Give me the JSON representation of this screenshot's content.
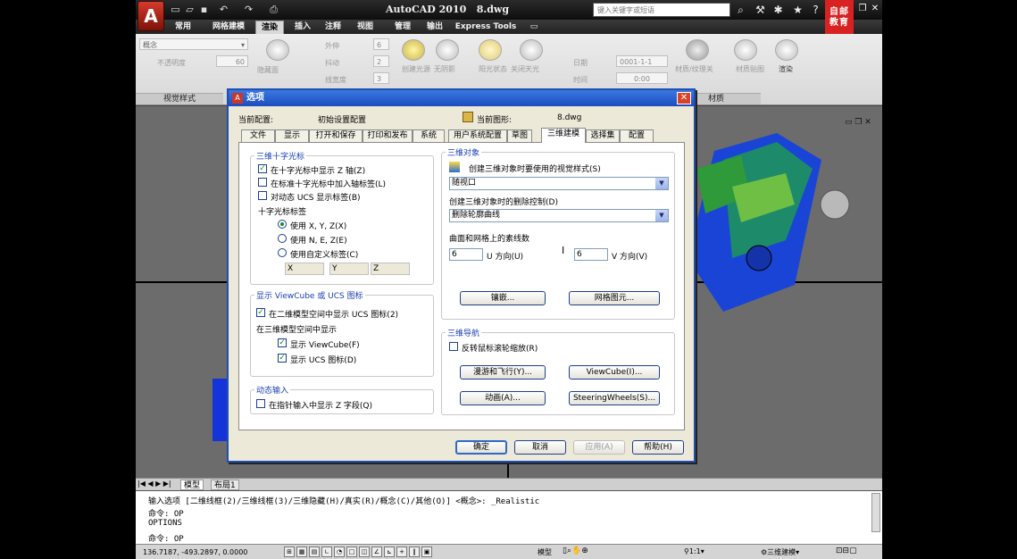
{
  "app": {
    "title": "AutoCAD 2010   8.dwg",
    "search_placeholder": "键入关键字或短语",
    "logo_glyph": "A",
    "brand_line1": "自邮",
    "brand_line2": "教育",
    "colors": {
      "titlebar": "#1a1a1a",
      "dialog_title": "#2a62d6",
      "brand": "#d82222"
    }
  },
  "ribbon_tabs": [
    "常用",
    "网格建模",
    "渲染",
    "插入",
    "注释",
    "视图",
    "管理",
    "输出",
    "Express Tools"
  ],
  "active_ribbon_tab": "渲染",
  "ribbon": {
    "visual_style": "概念",
    "visual_style_label": "视觉样式",
    "items": {
      "lumps": "外伸",
      "lumps_val": "6",
      "color_val": "2",
      "jitter": "抖动",
      "line_width": "线宽度",
      "line_width_val": "3",
      "opacity": "不透明度",
      "opacity_val": "60",
      "xray": "隐藏面",
      "lights": "创建光源",
      "no_shadow": "无阴影",
      "sun": "阳光状态",
      "sun_off": "关闭天光",
      "date_label": "日期",
      "date_val": "0001-1-1",
      "time_label": "时间",
      "time_val": "0:00",
      "materials_browser": "材质/纹理关",
      "material_map": "材质贴图",
      "render": "渲染",
      "materials": "材质"
    }
  },
  "dialog": {
    "title": "选项",
    "current_profile_label": "当前配置:",
    "current_profile_value": "初始设置配置",
    "current_drawing_label": "当前图形:",
    "current_drawing_value": "8.dwg",
    "tabs": [
      "文件",
      "显示",
      "打开和保存",
      "打印和发布",
      "系统",
      "用户系统配置",
      "草图",
      "三维建模",
      "选择集",
      "配置"
    ],
    "active_tab": "三维建模",
    "crosshair": {
      "group_title": "三维十字光标",
      "show_z_axis": "在十字光标中显示 Z 轴(Z)",
      "show_z_axis_checked": true,
      "label_axes": "在标准十字光标中加入轴标签(L)",
      "label_axes_checked": false,
      "dynamic_ucs_labels": "对动态 UCS 显示标签(B)",
      "dynamic_ucs_labels_checked": false,
      "crosshair_labels_title": "十字光标标签",
      "use_xyz": "使用 X, Y, Z(X)",
      "use_nez": "使用 N, E, Z(E)",
      "use_custom": "使用自定义标签(C)",
      "selected": "xyz",
      "custom_x": "X",
      "custom_y": "Y",
      "custom_z": "Z"
    },
    "viewcube": {
      "group_title": "显示 ViewCube 或 UCS 图标",
      "show_ucs_2d": "在二维模型空间中显示 UCS 图标(2)",
      "show_ucs_2d_checked": true,
      "in_3d_title": "在三维模型空间中显示",
      "show_viewcube": "显示 ViewCube(F)",
      "show_viewcube_checked": true,
      "show_ucs_icon": "显示 UCS 图标(D)",
      "show_ucs_icon_checked": true
    },
    "dynamic_input": {
      "group_title": "动态输入",
      "show_z_field": "在指针输入中显示 Z 字段(Q)",
      "show_z_field_checked": false
    },
    "objects_3d": {
      "group_title": "三维对象",
      "visual_style_label": "创建三维对象时要使用的视觉样式(S)",
      "visual_style_value": "随视口",
      "deletion_label": "创建三维对象时的删除控制(D)",
      "deletion_value": "删除轮廓曲线",
      "isolines_label": "曲面和网格上的素线数",
      "u_value": "6",
      "u_label": "U 方向(U)",
      "v_value": "6",
      "v_label": "V 方向(V)",
      "tessellation_button": "镶嵌...",
      "mesh_primitives_button": "网格图元..."
    },
    "navigation": {
      "group_title": "三维导航",
      "reverse_wheel": "反转鼠标滚轮缩放(R)",
      "reverse_wheel_checked": false,
      "walk_fly_button": "漫游和飞行(Y)...",
      "viewcube_button": "ViewCube(I)...",
      "animation_button": "动画(A)...",
      "steeringwheels_button": "SteeringWheels(S)..."
    },
    "buttons": {
      "ok": "确定",
      "cancel": "取消",
      "apply": "应用(A)",
      "help": "帮助(H)"
    }
  },
  "layout_tabs": [
    "模型",
    "布局1"
  ],
  "command": {
    "line1": "输入选项 [二维线框(2)/三维线框(3)/三维隐藏(H)/真实(R)/概念(C)/其他(O)] <概念>: _Realistic",
    "line2": "命令: OP",
    "line3": "OPTIONS",
    "prompt": "命令: OP"
  },
  "status": {
    "coords": "136.7187, -493.2897, 0.0000",
    "model": "模型",
    "scale": "1:1",
    "workspace": "三维建模"
  }
}
